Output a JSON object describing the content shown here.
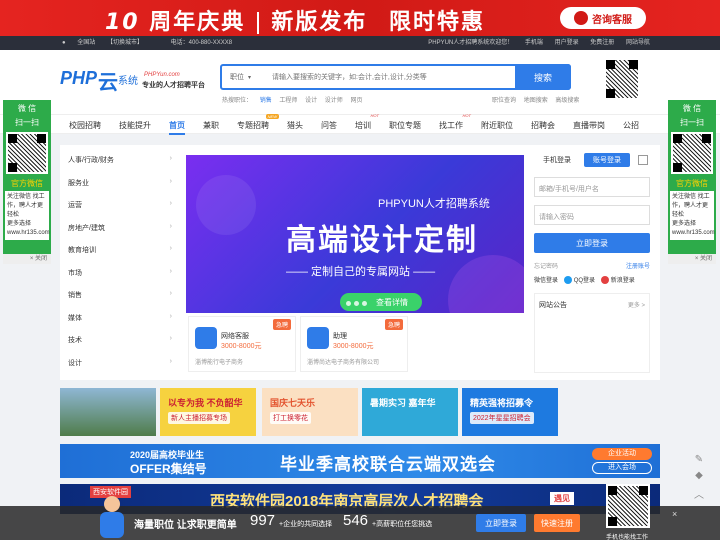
{
  "banner": {
    "ten": "10",
    "part1": "周年庆典",
    "part2": "新版发布",
    "part3": "限时特惠",
    "service_label": "咨询客服",
    "brand_color": "#d11a16"
  },
  "topbar": {
    "location": "全国站",
    "switch_city": "【切换城市】",
    "phone": "电话：400-880-XXXX8",
    "welcome": "PHPYUN人才招聘系统欢迎您！",
    "mobile": "手机端",
    "user_login": "用户登录",
    "register": "免费注册",
    "site_nav": "网站导航"
  },
  "logo": {
    "php": "PHP",
    "yun": "云",
    "xitong": "系统",
    "domain": "PHPYun.com",
    "slogan": "专业的人才招聘平台"
  },
  "search": {
    "category": "职位",
    "placeholder": "请输入要搜索的关键字，如:会计,会计,设计,分类等",
    "button": "搜索"
  },
  "hot": {
    "label": "热搜职位：",
    "items": [
      "销售",
      "工程师",
      "设计",
      "设计师",
      "网页"
    ],
    "right": [
      "职位查询",
      "地图搜索",
      "高级搜索"
    ]
  },
  "nav": {
    "items": [
      "校园招聘",
      "技能提升",
      "首页",
      "兼职",
      "专题招聘",
      "猎头",
      "问答",
      "培训",
      "职位专题",
      "找工作",
      "附近职位",
      "招聘会",
      "直播带岗",
      "公招"
    ],
    "new_badge": "NEW",
    "hot_badge": "HOT"
  },
  "side_qr": {
    "title1": "微 信",
    "title2": "扫一扫",
    "follow": "官方微信",
    "desc": "关注微信 找工作，聘人才更轻松",
    "more": "更多选择 www.hr135.com",
    "close": "关闭"
  },
  "categories": [
    "人事/行政/财务",
    "服务业",
    "运营",
    "房地产/建筑",
    "教育培训",
    "市场",
    "销售",
    "媒体",
    "技术",
    "设计"
  ],
  "hero": {
    "line1": "PHPYUN人才招聘系统",
    "line2": "高端设计定制",
    "line3": "—— 定制自己的专属网站 ——",
    "btn": "查看详情"
  },
  "job_cards": [
    {
      "name": "网络客服",
      "salary": "3000-8000元",
      "company": "淄博能行电子商务",
      "tag": "急聘"
    },
    {
      "name": "助理",
      "salary": "3000-8000元",
      "company": "淄博尚达电子商务有限公司",
      "tag": "急聘"
    }
  ],
  "login": {
    "tab_mobile": "手机登录",
    "tab_account": "账号登录",
    "email_placeholder": "邮箱/手机号/用户名",
    "pwd_placeholder": "请输入密码",
    "button": "立即登录",
    "forgot": "忘记密码",
    "register": "注册账号",
    "social": "微信登录",
    "qq": "QQ登录",
    "weibo": "新浪登录"
  },
  "notice": {
    "title": "网站公告",
    "more": "更多 >"
  },
  "ads": [
    {
      "t": "",
      "b": ""
    },
    {
      "t": "以专为我 不负韶华",
      "b": "新人主播招募专场"
    },
    {
      "t": "国庆七天乐",
      "b": "打工换零花"
    },
    {
      "t": "暑期实习 嘉年华",
      "b": ""
    },
    {
      "t": "精英强将招募令",
      "b": "2022年星星招聘会"
    }
  ],
  "wide1": {
    "a": "2020届高校毕业生",
    "b": "OFFER集结号",
    "c": "毕业季高校联合云端双选会",
    "d": "企业活动",
    "e": "进入会场"
  },
  "wide2": {
    "a": "西安软件园",
    "b": "西安软件园2018年南京高层次人才招聘会",
    "c": "遇见"
  },
  "bottom": {
    "slogan": "海量职位 让求职更简单",
    "n1": "997",
    "t1": "+企业的共同选择",
    "n2": "546",
    "t2": "+高薪职位任您挑选",
    "login": "立即登录",
    "reg": "快速注册",
    "download": "手机也能找工作",
    "close": "×"
  }
}
